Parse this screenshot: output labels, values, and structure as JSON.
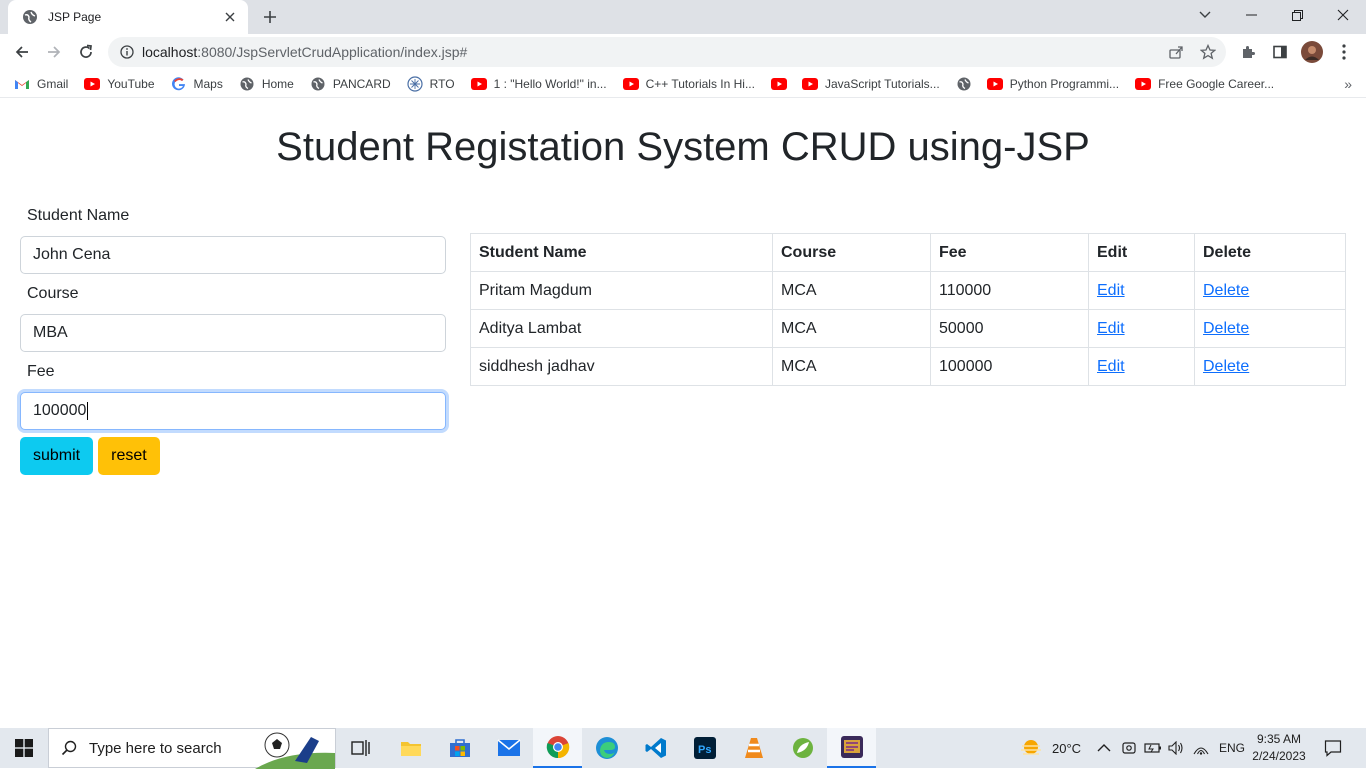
{
  "browser": {
    "tab_title": "JSP Page",
    "url_host": "localhost",
    "url_rest": ":8080/JspServletCrudApplication/index.jsp#",
    "bookmarks": [
      {
        "label": "Gmail",
        "icon": "gmail-icon"
      },
      {
        "label": "YouTube",
        "icon": "youtube-icon"
      },
      {
        "label": "Maps",
        "icon": "google-icon"
      },
      {
        "label": "Home",
        "icon": "globe-icon"
      },
      {
        "label": "PANCARD",
        "icon": "globe-icon"
      },
      {
        "label": "RTO",
        "icon": "rto-icon"
      },
      {
        "label": "1 : \"Hello World!\" in...",
        "icon": "youtube-icon"
      },
      {
        "label": "C++ Tutorials In Hi...",
        "icon": "youtube-icon"
      },
      {
        "label": "",
        "icon": "youtube-icon"
      },
      {
        "label": "JavaScript Tutorials...",
        "icon": "youtube-icon"
      },
      {
        "label": "",
        "icon": "globe-icon"
      },
      {
        "label": "Python Programmi...",
        "icon": "youtube-icon"
      },
      {
        "label": "Free Google Career...",
        "icon": "youtube-icon"
      }
    ],
    "bookmarks_more": "»"
  },
  "page": {
    "title": "Student Registation System CRUD using-JSP",
    "form": {
      "name_label": "Student Name",
      "name_value": "John Cena",
      "course_label": "Course",
      "course_value": "MBA",
      "fee_label": "Fee",
      "fee_value": "100000",
      "submit_label": "submit",
      "reset_label": "reset"
    },
    "table": {
      "headers": [
        "Student Name",
        "Course",
        "Fee",
        "Edit",
        "Delete"
      ],
      "rows": [
        {
          "name": "Pritam Magdum",
          "course": "MCA",
          "fee": "110000",
          "edit": "Edit",
          "delete": "Delete"
        },
        {
          "name": "Aditya Lambat",
          "course": "MCA",
          "fee": "50000",
          "edit": "Edit",
          "delete": "Delete"
        },
        {
          "name": "siddhesh jadhav",
          "course": "MCA",
          "fee": "100000",
          "edit": "Edit",
          "delete": "Delete"
        }
      ]
    }
  },
  "taskbar": {
    "search_placeholder": "Type here to search",
    "weather": "20°C",
    "language": "ENG",
    "time": "9:35 AM",
    "date": "2/24/2023"
  },
  "colors": {
    "submit": "#0dcaf0",
    "reset": "#ffc107",
    "link": "#0d6efd"
  }
}
